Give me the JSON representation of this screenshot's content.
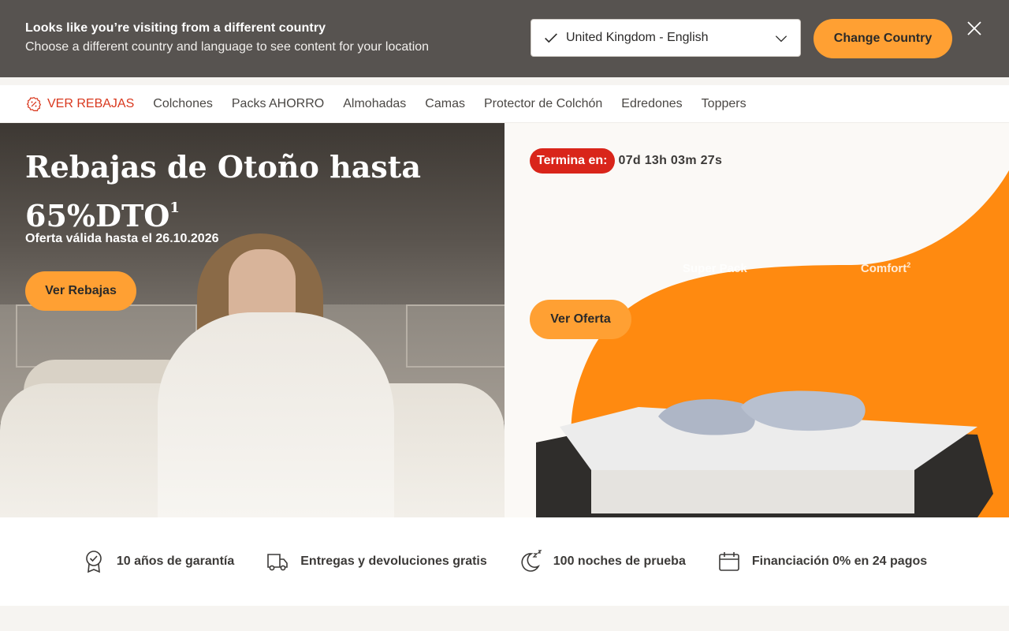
{
  "banner": {
    "title": "Looks like you’re visiting from a different country",
    "subtitle": "Choose a different country and language to see content for your location",
    "selected_country": "United Kingdom - English",
    "change_button": "Change Country"
  },
  "nav": {
    "items": [
      {
        "label": "VER REBAJAS",
        "icon": "sale-badge-icon"
      },
      {
        "label": "Colchones"
      },
      {
        "label": "Packs AHORRO"
      },
      {
        "label": "Almohadas"
      },
      {
        "label": "Camas"
      },
      {
        "label": "Protector de Colchón"
      },
      {
        "label": "Edredones"
      },
      {
        "label": "Toppers"
      }
    ]
  },
  "hero_left": {
    "title_line1": "Rebajas de Otoño hasta",
    "title_line2": "65%DTO",
    "title_sup": "1",
    "valid": "Oferta válida hasta el 26.10.2026",
    "button": "Ver Rebajas"
  },
  "hero_right": {
    "timer_label": "Termina en:",
    "timer_value": "07d 13h 03m 27s",
    "subtitle": "Super Pack",
    "subtitle_suffix": "Comfort",
    "subtitle_sup": "2",
    "button": "Ver Oferta"
  },
  "usp": [
    {
      "label": "10 años de garantía",
      "icon": "warranty-badge-icon"
    },
    {
      "label": "Entregas y devoluciones gratis",
      "icon": "delivery-truck-icon"
    },
    {
      "label": "100 noches de prueba",
      "icon": "moon-sleep-icon"
    },
    {
      "label": "Financiación 0% en 24 pagos",
      "icon": "calendar-icon"
    }
  ],
  "colors": {
    "banner_bg": "#575350",
    "accent": "#ffa033",
    "sale_red": "#d9381e",
    "timer_red": "#d9251a"
  }
}
